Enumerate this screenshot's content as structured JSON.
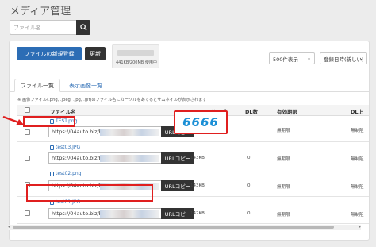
{
  "page_title": "メディア管理",
  "search": {
    "placeholder": "ファイル名"
  },
  "toolbar": {
    "new_upload_label": "ファイルの新規登録",
    "refresh_label": "更新",
    "storage_text": "441KB/200MB 使用中",
    "per_page_value": "500件表示",
    "sort_value": "登録日時(新しい)"
  },
  "tabs": [
    "ファイル一覧",
    "表示画像一覧"
  ],
  "note": "※ 画像ファイル(.png, .jpeg, .jpg, .gif)のファイル名にカーソルをあてるとサムネイルが表示されます",
  "columns": {
    "filename": "ファイル名",
    "filesize": "ファイルサイズ",
    "dl_count": "DL数",
    "expiry": "有効期限",
    "dl_expiry": "DL上"
  },
  "rows": [
    {
      "filename": "TEST.png",
      "url": "https://04auto.biz/brd/",
      "copy_label": "URLコピー",
      "size": "",
      "dl": "",
      "expiry": "無期限",
      "dl_expiry": "無制阻"
    },
    {
      "filename": "test03.JPG",
      "url": "https://04auto.biz/brd/",
      "copy_label": "URLコピー",
      "size": "143KB",
      "dl": "0",
      "expiry": "無期限",
      "dl_expiry": "無制阻"
    },
    {
      "filename": "test02.png",
      "url": "https://04auto.biz/brd/",
      "copy_label": "URLコピー",
      "size": "143KB",
      "dl": "0",
      "expiry": "無期限",
      "dl_expiry": "無制阻"
    },
    {
      "filename": "test01.JPG",
      "url": "https://04auto.biz/brd/",
      "copy_label": "URLコピー",
      "size": "142KB",
      "dl": "0",
      "expiry": "無期限",
      "dl_expiry": "無制阻"
    }
  ],
  "code_callout": "6666",
  "colors": {
    "primary": "#2c6db5",
    "dark": "#333333",
    "highlight": "#e01f1f",
    "code": "#1a8fd6"
  }
}
